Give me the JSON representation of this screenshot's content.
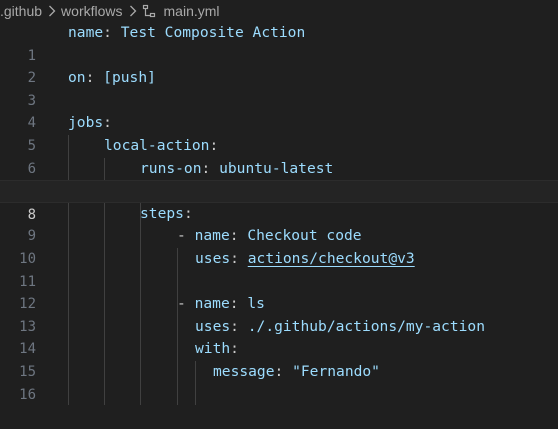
{
  "breadcrumb": {
    "items": [
      ".github",
      "workflows",
      "main.yml"
    ]
  },
  "editor": {
    "active_line": 8,
    "line_numbers": [
      "1",
      "2",
      "3",
      "4",
      "5",
      "6",
      "7",
      "8",
      "9",
      "10",
      "11",
      "12",
      "13",
      "14",
      "15",
      "16"
    ],
    "lines": {
      "l1": {
        "key": "name",
        "colon": ":",
        "value": "Test Composite Action"
      },
      "l3": {
        "key": "on",
        "colon": ":",
        "value": "[push]"
      },
      "l5": {
        "key": "jobs",
        "colon": ":"
      },
      "l6": {
        "key": "local-action",
        "colon": ":"
      },
      "l7": {
        "key": "runs-on",
        "colon": ":",
        "value": "ubuntu-latest"
      },
      "l9": {
        "key": "steps",
        "colon": ":"
      },
      "l10": {
        "dash": "-",
        "key": "name",
        "colon": ":",
        "value": "Checkout code"
      },
      "l11": {
        "key": "uses",
        "colon": ":",
        "value": "actions/checkout@v3"
      },
      "l13": {
        "dash": "-",
        "key": "name",
        "colon": ":",
        "value": "ls"
      },
      "l14": {
        "key": "uses",
        "colon": ":",
        "value": "./.github/actions/my-action"
      },
      "l15": {
        "key": "with",
        "colon": ":"
      },
      "l16": {
        "key": "message",
        "colon": ":",
        "value": "\"Fernando\""
      }
    }
  },
  "colors": {
    "background": "#1f1f1f",
    "key": "#9cdcfe",
    "line_number": "#6e7681",
    "text": "#cccccc"
  }
}
